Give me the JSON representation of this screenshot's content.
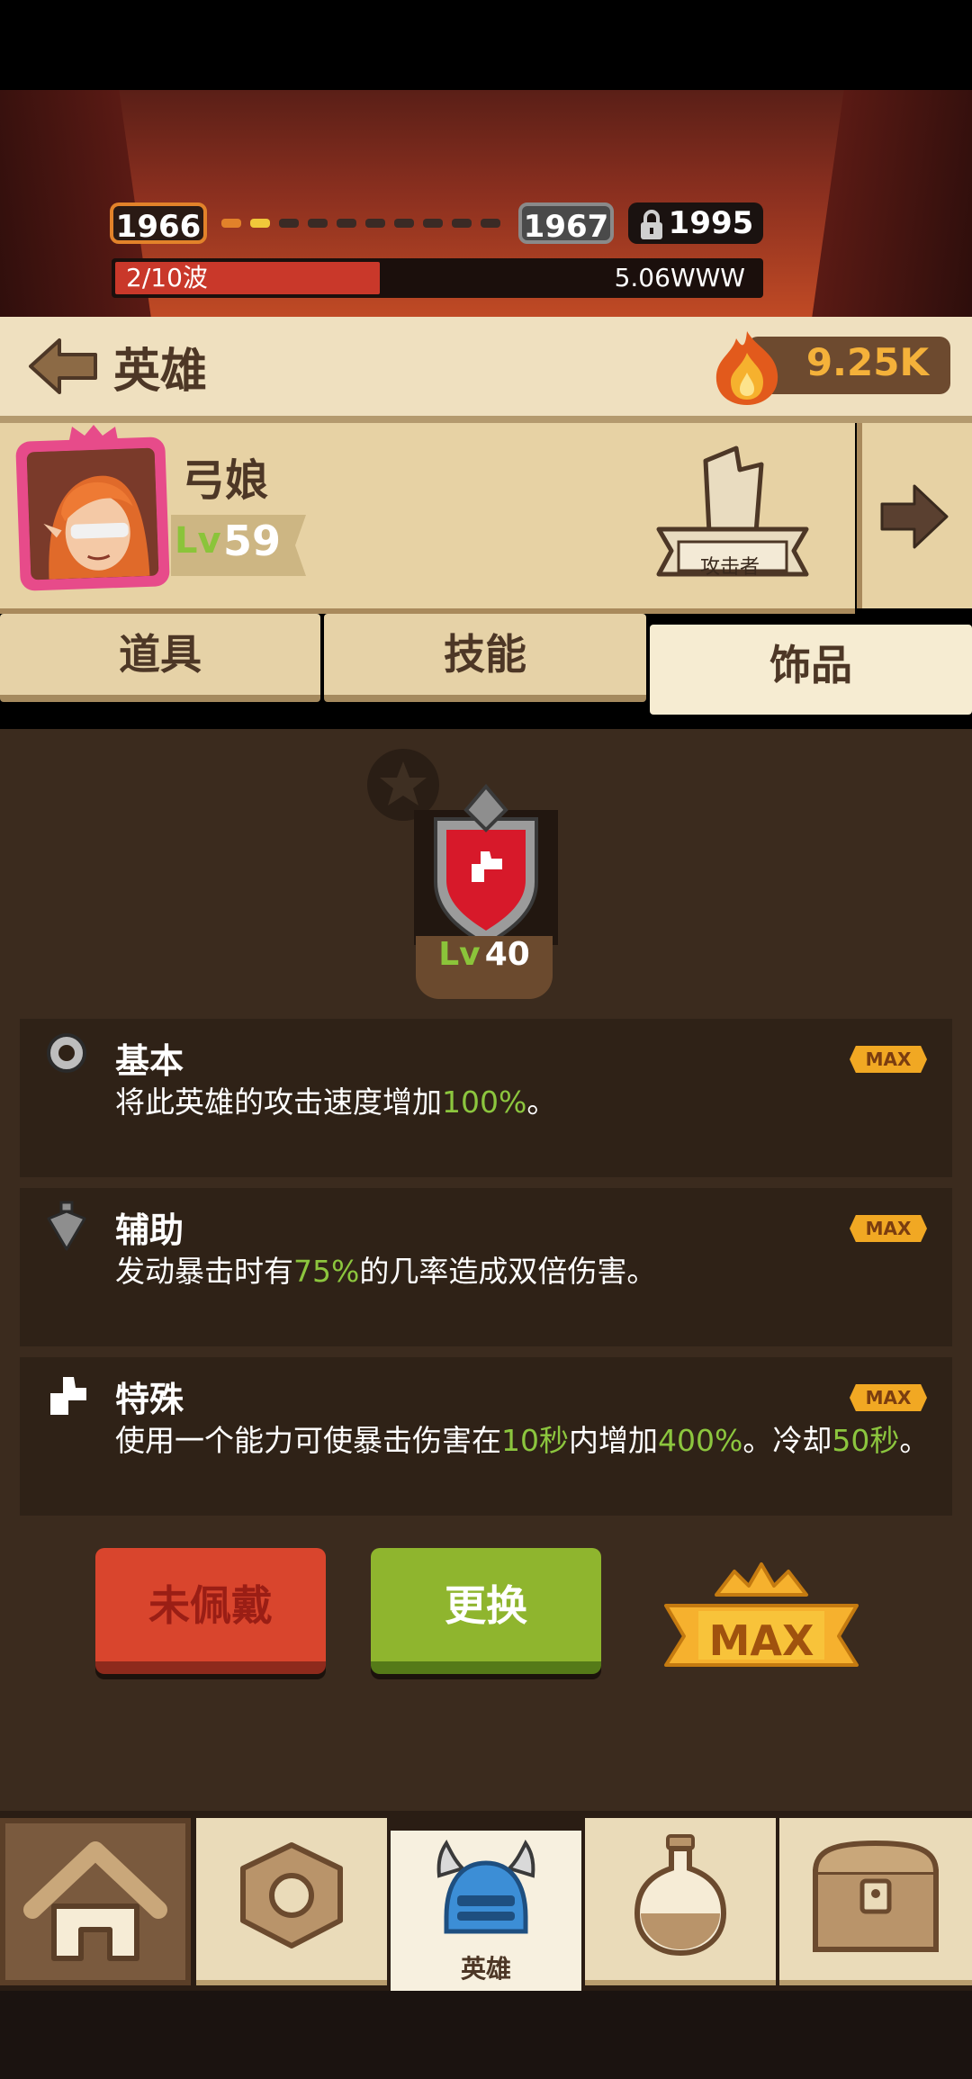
{
  "top_hud": {
    "current_stage": "1966",
    "next_stage": "1967",
    "locked_stage": "1995",
    "wave_progress": "2/10波",
    "wave_fraction": 0.2,
    "damage": "5.06WWW"
  },
  "header": {
    "title": "英雄",
    "gems": "9.25K"
  },
  "hero": {
    "name": "弓娘",
    "level_prefix": "Lv",
    "level": "59",
    "class_label": "攻击者"
  },
  "tabs": [
    {
      "label": "道具"
    },
    {
      "label": "技能"
    },
    {
      "label": "饰品"
    }
  ],
  "item": {
    "level_prefix": "Lv",
    "level": "40"
  },
  "stats": [
    {
      "title": "基本",
      "desc_pre": "将此英雄的攻击速度增加",
      "desc_v1": "100%",
      "desc_post": "。",
      "max": "MAX"
    },
    {
      "title": "辅助",
      "desc_pre": "发动暴击时有",
      "desc_v1": "75%",
      "desc_post": "的几率造成双倍伤害。",
      "max": "MAX"
    },
    {
      "title": "特殊",
      "desc_pre": "使用一个能力可使暴击伤害在",
      "desc_v1": "10秒",
      "desc_mid": "内增加",
      "desc_v2": "400%",
      "desc_mid2": "。冷却",
      "desc_v3": "50秒",
      "desc_post": "。",
      "max": "MAX"
    }
  ],
  "buttons": {
    "unequipped": "未佩戴",
    "replace": "更换",
    "max": "MAX"
  },
  "nav": {
    "hero_label": "英雄"
  },
  "colors": {
    "accent_green": "#8cc63e",
    "gem_orange": "#f4b13a",
    "red_button": "#d9452d",
    "green_button": "#8fb52e"
  }
}
